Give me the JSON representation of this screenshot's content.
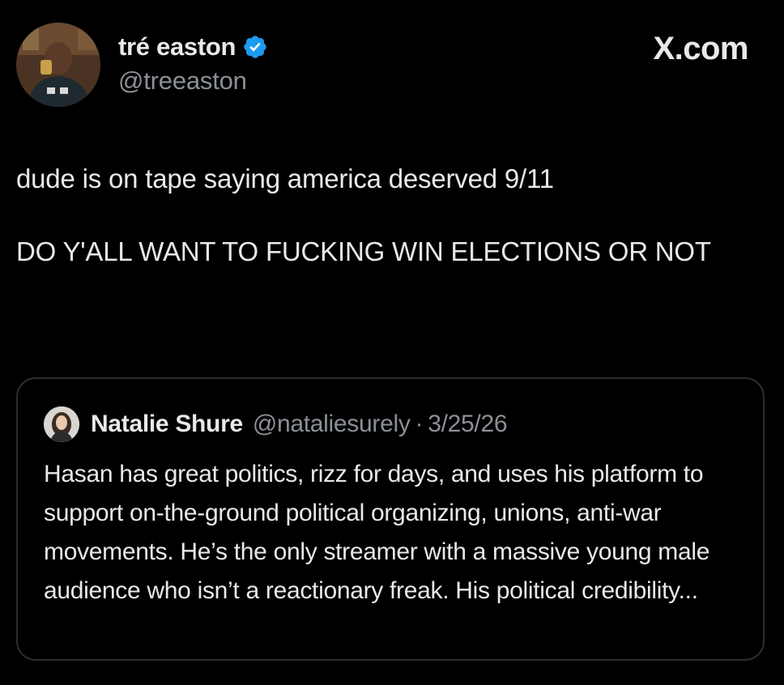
{
  "author": {
    "display_name": "tré easton",
    "handle": "@treeaston",
    "verified": true,
    "verified_color": "#1d9bf0"
  },
  "site_label": "X.com",
  "tweet": {
    "line1": "dude is on tape saying america deserved 9/11",
    "line2": "DO Y'ALL WANT TO FUCKING WIN ELECTIONS OR NOT"
  },
  "quoted": {
    "display_name": "Natalie Shure",
    "handle": "@nataliesurely",
    "separator": "·",
    "date": "3/25/26",
    "text": "Hasan has great politics, rizz for days, and uses his platform to support on-the-ground political organizing, unions, anti-war movements. He’s the only streamer with a massive young male audience who isn’t a reactionary freak. His political credibility..."
  },
  "icons": {
    "verified": "verified-badge-icon"
  },
  "colors": {
    "background": "#000000",
    "text": "#e7e9ea",
    "muted": "#8b9096",
    "border": "#2a2d31"
  }
}
